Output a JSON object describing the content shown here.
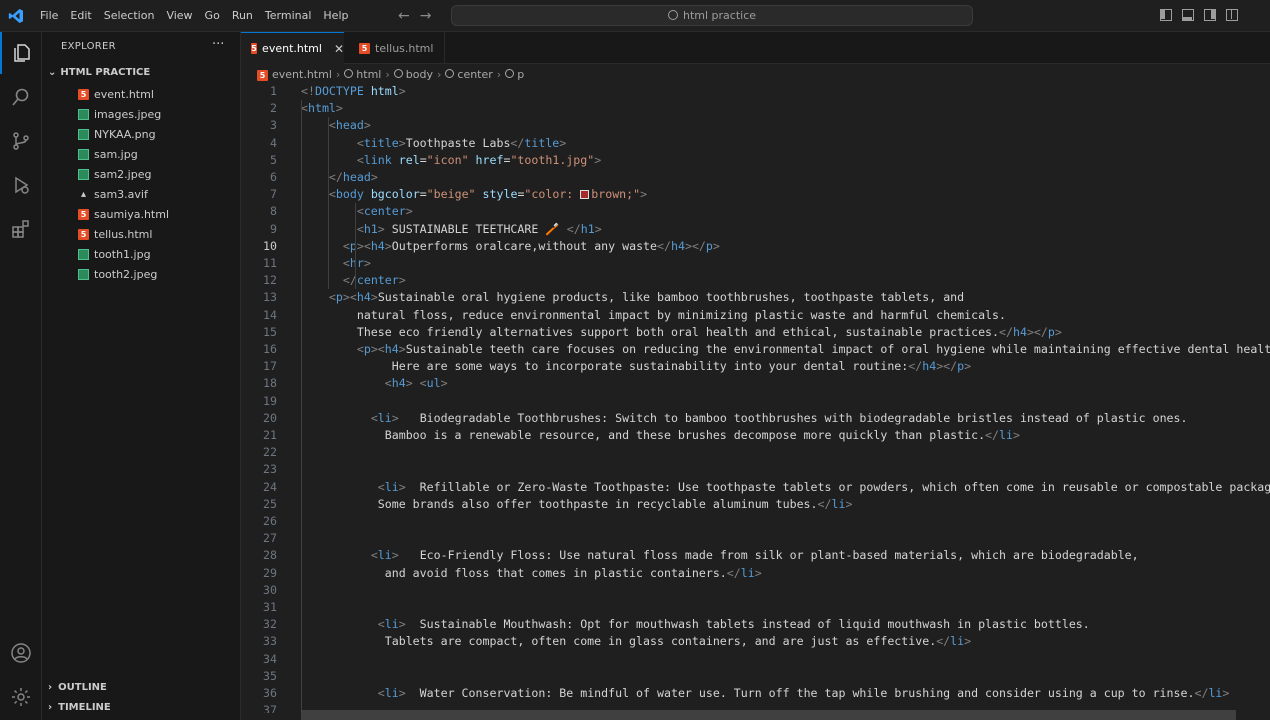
{
  "menu": [
    "File",
    "Edit",
    "Selection",
    "View",
    "Go",
    "Run",
    "Terminal",
    "Help"
  ],
  "search": "html practice",
  "icons": {
    "app": "vscode-logo-icon",
    "explorer": "files-icon",
    "search": "search-icon",
    "scm": "source-control-icon",
    "debug": "run-debug-icon",
    "extensions": "extensions-icon",
    "account": "account-icon",
    "settings": "gear-icon"
  },
  "colors": {
    "accent": "#0078d4",
    "html_icon": "#e44d26",
    "image_icon": "#4fc08d",
    "brown_swatch": "#a52a2a"
  },
  "sidebar": {
    "title": "EXPLORER",
    "more": "···",
    "folder": "HTML PRACTICE",
    "files": [
      {
        "name": "event.html",
        "type": "html"
      },
      {
        "name": "images.jpeg",
        "type": "img"
      },
      {
        "name": "NYKAA.png",
        "type": "img"
      },
      {
        "name": "sam.jpg",
        "type": "img"
      },
      {
        "name": "sam2.jpeg",
        "type": "img"
      },
      {
        "name": "sam3.avif",
        "type": "avif"
      },
      {
        "name": "saumiya.html",
        "type": "html"
      },
      {
        "name": "tellus.html",
        "type": "html"
      },
      {
        "name": "tooth1.jpg",
        "type": "img"
      },
      {
        "name": "tooth2.jpeg",
        "type": "img"
      }
    ],
    "outline": "OUTLINE",
    "timeline": "TIMELINE"
  },
  "tabs": [
    {
      "label": "event.html",
      "active": true
    },
    {
      "label": "tellus.html",
      "active": false
    }
  ],
  "breadcrumbs": [
    "event.html",
    "html",
    "body",
    "center",
    "p"
  ],
  "current_line": 10,
  "code": [
    {
      "n": "1",
      "t": [
        [
          "b",
          "<!"
        ],
        [
          "d",
          "DOCTYPE"
        ],
        [
          "x",
          " "
        ],
        [
          "a",
          "html"
        ],
        [
          "b",
          ">"
        ]
      ]
    },
    {
      "n": "2",
      "t": [
        [
          "b",
          "<"
        ],
        [
          "t",
          "html"
        ],
        [
          "b",
          ">"
        ]
      ]
    },
    {
      "n": "3",
      "t": [
        [
          "x",
          "    "
        ],
        [
          "b",
          "<"
        ],
        [
          "t",
          "head"
        ],
        [
          "b",
          ">"
        ]
      ]
    },
    {
      "n": "4",
      "t": [
        [
          "x",
          "        "
        ],
        [
          "b",
          "<"
        ],
        [
          "t",
          "title"
        ],
        [
          "b",
          ">"
        ],
        [
          "x",
          "Toothpaste Labs"
        ],
        [
          "b",
          "</"
        ],
        [
          "t",
          "title"
        ],
        [
          "b",
          ">"
        ]
      ]
    },
    {
      "n": "5",
      "t": [
        [
          "x",
          "        "
        ],
        [
          "b",
          "<"
        ],
        [
          "t",
          "link"
        ],
        [
          "x",
          " "
        ],
        [
          "a",
          "rel"
        ],
        [
          "x",
          "="
        ],
        [
          "s",
          "\"icon\""
        ],
        [
          "x",
          " "
        ],
        [
          "a",
          "href"
        ],
        [
          "x",
          "="
        ],
        [
          "s",
          "\"tooth1.jpg\""
        ],
        [
          "b",
          ">"
        ]
      ]
    },
    {
      "n": "6",
      "t": [
        [
          "x",
          "    "
        ],
        [
          "b",
          "</"
        ],
        [
          "t",
          "head"
        ],
        [
          "b",
          ">"
        ]
      ]
    },
    {
      "n": "7",
      "t": [
        [
          "x",
          "    "
        ],
        [
          "b",
          "<"
        ],
        [
          "t",
          "body"
        ],
        [
          "x",
          " "
        ],
        [
          "a",
          "bgcolor"
        ],
        [
          "x",
          "="
        ],
        [
          "s",
          "\"beige\""
        ],
        [
          "x",
          " "
        ],
        [
          "a",
          "style"
        ],
        [
          "x",
          "="
        ],
        [
          "s",
          "\"color: "
        ],
        [
          "sw",
          ""
        ],
        [
          "s",
          "brown;\""
        ],
        [
          "b",
          ">"
        ]
      ]
    },
    {
      "n": "8",
      "t": [
        [
          "x",
          "        "
        ],
        [
          "b",
          "<"
        ],
        [
          "t",
          "center"
        ],
        [
          "b",
          ">"
        ]
      ]
    },
    {
      "n": "9",
      "t": [
        [
          "x",
          "        "
        ],
        [
          "b",
          "<"
        ],
        [
          "t",
          "h1"
        ],
        [
          "b",
          ">"
        ],
        [
          "x",
          " SUSTAINABLE TEETHCARE 🪥 "
        ],
        [
          "b",
          "</"
        ],
        [
          "t",
          "h1"
        ],
        [
          "b",
          ">"
        ]
      ]
    },
    {
      "n": "10",
      "t": [
        [
          "x",
          "      "
        ],
        [
          "b",
          "<"
        ],
        [
          "t",
          "p"
        ],
        [
          "b",
          "><"
        ],
        [
          "t",
          "h4"
        ],
        [
          "b",
          ">"
        ],
        [
          "x",
          "Outperforms oralcare,without any waste"
        ],
        [
          "b",
          "</"
        ],
        [
          "t",
          "h4"
        ],
        [
          "b",
          "></"
        ],
        [
          "t",
          "p"
        ],
        [
          "b",
          ">"
        ]
      ]
    },
    {
      "n": "11",
      "t": [
        [
          "x",
          "      "
        ],
        [
          "b",
          "<"
        ],
        [
          "t",
          "hr"
        ],
        [
          "b",
          ">"
        ]
      ]
    },
    {
      "n": "12",
      "t": [
        [
          "x",
          "      "
        ],
        [
          "b",
          "</"
        ],
        [
          "t",
          "center"
        ],
        [
          "b",
          ">"
        ]
      ]
    },
    {
      "n": "13",
      "t": [
        [
          "x",
          "    "
        ],
        [
          "b",
          "<"
        ],
        [
          "t",
          "p"
        ],
        [
          "b",
          "><"
        ],
        [
          "t",
          "h4"
        ],
        [
          "b",
          ">"
        ],
        [
          "x",
          "Sustainable oral hygiene products, like bamboo toothbrushes, toothpaste tablets, and"
        ]
      ]
    },
    {
      "n": "14",
      "t": [
        [
          "x",
          "        natural floss, reduce environmental impact by minimizing plastic waste and harmful chemicals."
        ]
      ]
    },
    {
      "n": "15",
      "t": [
        [
          "x",
          "        These eco friendly alternatives support both oral health and ethical, sustainable practices."
        ],
        [
          "b",
          "</"
        ],
        [
          "t",
          "h4"
        ],
        [
          "b",
          "></"
        ],
        [
          "t",
          "p"
        ],
        [
          "b",
          ">"
        ]
      ]
    },
    {
      "n": "16",
      "t": [
        [
          "x",
          "        "
        ],
        [
          "b",
          "<"
        ],
        [
          "t",
          "p"
        ],
        [
          "b",
          "><"
        ],
        [
          "t",
          "h4"
        ],
        [
          "b",
          ">"
        ],
        [
          "x",
          "Sustainable teeth care focuses on reducing the environmental impact of oral hygiene while maintaining effective dental health."
        ]
      ]
    },
    {
      "n": "17",
      "t": [
        [
          "x",
          "             Here are some ways to incorporate sustainability into your dental routine:"
        ],
        [
          "b",
          "</"
        ],
        [
          "t",
          "h4"
        ],
        [
          "b",
          "></"
        ],
        [
          "t",
          "p"
        ],
        [
          "b",
          ">"
        ]
      ]
    },
    {
      "n": "18",
      "t": [
        [
          "x",
          "            "
        ],
        [
          "b",
          "<"
        ],
        [
          "t",
          "h4"
        ],
        [
          "b",
          "> <"
        ],
        [
          "t",
          "ul"
        ],
        [
          "b",
          ">"
        ]
      ]
    },
    {
      "n": "19",
      "t": []
    },
    {
      "n": "20",
      "t": [
        [
          "x",
          "          "
        ],
        [
          "b",
          "<"
        ],
        [
          "t",
          "li"
        ],
        [
          "b",
          ">"
        ],
        [
          "x",
          "   Biodegradable Toothbrushes: Switch to bamboo toothbrushes with biodegradable bristles instead of plastic ones."
        ]
      ]
    },
    {
      "n": "21",
      "t": [
        [
          "x",
          "            Bamboo is a renewable resource, and these brushes decompose more quickly than plastic."
        ],
        [
          "b",
          "</"
        ],
        [
          "t",
          "li"
        ],
        [
          "b",
          ">"
        ]
      ]
    },
    {
      "n": "22",
      "t": []
    },
    {
      "n": "23",
      "t": []
    },
    {
      "n": "24",
      "t": [
        [
          "x",
          "           "
        ],
        [
          "b",
          "<"
        ],
        [
          "t",
          "li"
        ],
        [
          "b",
          ">"
        ],
        [
          "x",
          "  Refillable or Zero-Waste Toothpaste: Use toothpaste tablets or powders, which often come in reusable or compostable packaging."
        ]
      ]
    },
    {
      "n": "25",
      "t": [
        [
          "x",
          "           Some brands also offer toothpaste in recyclable aluminum tubes."
        ],
        [
          "b",
          "</"
        ],
        [
          "t",
          "li"
        ],
        [
          "b",
          ">"
        ]
      ]
    },
    {
      "n": "26",
      "t": []
    },
    {
      "n": "27",
      "t": []
    },
    {
      "n": "28",
      "t": [
        [
          "x",
          "          "
        ],
        [
          "b",
          "<"
        ],
        [
          "t",
          "li"
        ],
        [
          "b",
          ">"
        ],
        [
          "x",
          "   Eco-Friendly Floss: Use natural floss made from silk or plant-based materials, which are biodegradable,"
        ]
      ]
    },
    {
      "n": "29",
      "t": [
        [
          "x",
          "            and avoid floss that comes in plastic containers."
        ],
        [
          "b",
          "</"
        ],
        [
          "t",
          "li"
        ],
        [
          "b",
          ">"
        ]
      ]
    },
    {
      "n": "30",
      "t": []
    },
    {
      "n": "31",
      "t": []
    },
    {
      "n": "32",
      "t": [
        [
          "x",
          "           "
        ],
        [
          "b",
          "<"
        ],
        [
          "t",
          "li"
        ],
        [
          "b",
          ">"
        ],
        [
          "x",
          "  Sustainable Mouthwash: Opt for mouthwash tablets instead of liquid mouthwash in plastic bottles."
        ]
      ]
    },
    {
      "n": "33",
      "t": [
        [
          "x",
          "            Tablets are compact, often come in glass containers, and are just as effective."
        ],
        [
          "b",
          "</"
        ],
        [
          "t",
          "li"
        ],
        [
          "b",
          ">"
        ]
      ]
    },
    {
      "n": "34",
      "t": []
    },
    {
      "n": "35",
      "t": []
    },
    {
      "n": "36",
      "t": [
        [
          "x",
          "           "
        ],
        [
          "b",
          "<"
        ],
        [
          "t",
          "li"
        ],
        [
          "b",
          ">"
        ],
        [
          "x",
          "  Water Conservation: Be mindful of water use. Turn off the tap while brushing and consider using a cup to rinse."
        ],
        [
          "b",
          "</"
        ],
        [
          "t",
          "li"
        ],
        [
          "b",
          ">"
        ]
      ]
    },
    {
      "n": "37",
      "t": []
    }
  ]
}
